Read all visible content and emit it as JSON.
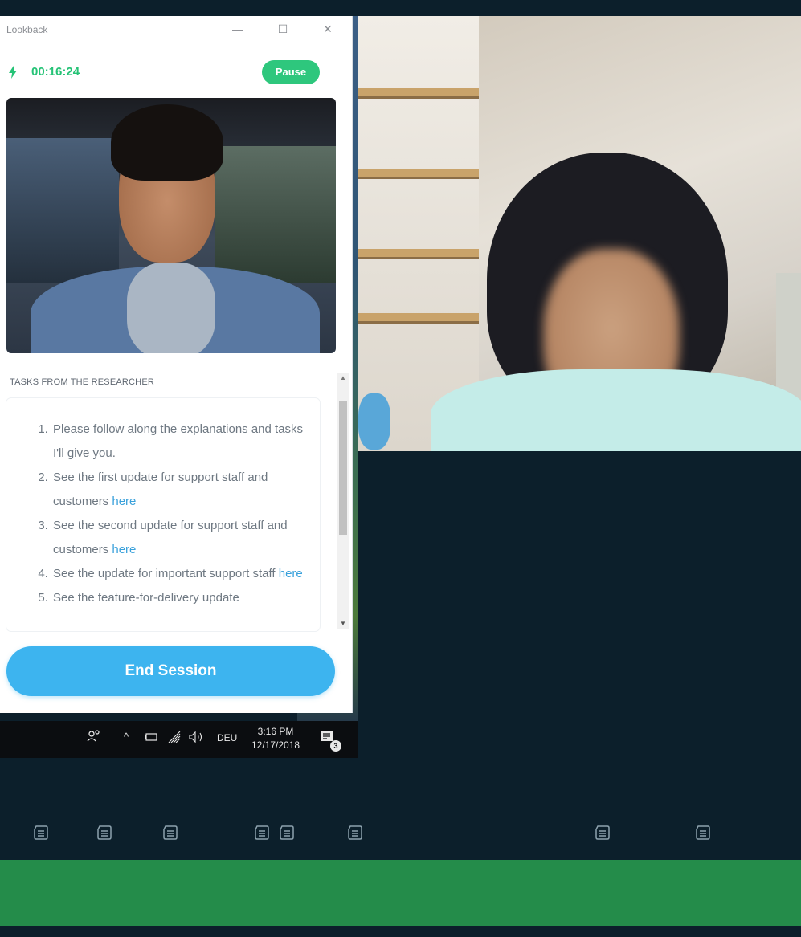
{
  "lookback_window": {
    "title": "Lookback",
    "window_controls": {
      "minimize": "—",
      "maximize": "☐",
      "close": "✕"
    },
    "recording": {
      "status_icon": "bolt-icon",
      "elapsed": "00:16:24",
      "pause_label": "Pause"
    },
    "tasks": {
      "header": "TASKS FROM THE RESEARCHER",
      "items": [
        {
          "text": "Please follow along the explanations and tasks I'll give you.",
          "link": ""
        },
        {
          "text": "See the first update for support staff and customers ",
          "link": "here"
        },
        {
          "text": "See the second update for support staff and customers ",
          "link": "here"
        },
        {
          "text": "See the update for important support staff ",
          "link": "here"
        },
        {
          "text": "See the feature-for-delivery update",
          "link": ""
        }
      ]
    },
    "end_session_label": "End Session"
  },
  "taskbar": {
    "people_icon": "people-icon",
    "tray_chevron": "^",
    "battery_icon": "battery-icon",
    "wifi_icon": "wifi-icon",
    "volume_icon": "volume-icon",
    "language": "DEU",
    "time": "3:16 PM",
    "date": "12/17/2018",
    "notification_count": "3"
  },
  "timeline": {
    "note_markers": [
      "note-icon",
      "note-icon",
      "note-icon",
      "note-icon",
      "note-icon",
      "note-icon",
      "note-icon",
      "note-icon"
    ]
  },
  "colors": {
    "accent_green": "#2ec77d",
    "end_session_blue": "#3db4ef",
    "link_blue": "#3aa1db",
    "background_dark": "#0c1f2b",
    "progress_green": "#248c4a"
  }
}
